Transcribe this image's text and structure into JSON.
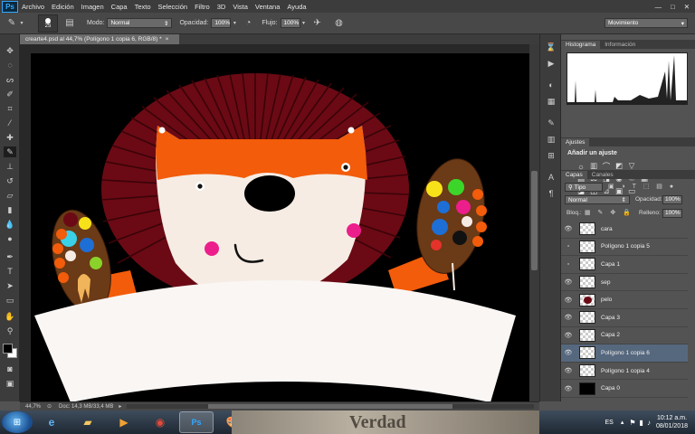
{
  "app": {
    "logo": "Ps"
  },
  "menu": [
    "Archivo",
    "Edición",
    "Imagen",
    "Capa",
    "Texto",
    "Selección",
    "Filtro",
    "3D",
    "Vista",
    "Ventana",
    "Ayuda"
  ],
  "options": {
    "brush_size": "25",
    "mode_label": "Modo:",
    "mode_value": "Normal",
    "opacity_label": "Opacidad:",
    "opacity_value": "100%",
    "flow_label": "Flujo:",
    "flow_value": "100%",
    "workspace": "Movimiento"
  },
  "document": {
    "tab_title": "crearte4.psd al 44,7% (Polígono 1 copia 6, RGB/8) *",
    "zoom": "44,7%",
    "doc_info": "Doc: 14,3 MB/33,4 MB"
  },
  "panels": {
    "histogram_tab": "Histograma",
    "info_tab": "Información",
    "adjustments_tab": "Ajustes",
    "add_adjustment": "Añadir un ajuste",
    "layers_tab": "Capas",
    "channels_tab": "Canales",
    "filter_kind": "Tipo",
    "blend_mode": "Normal",
    "opacity_label": "Opacidad:",
    "opacity_value": "100%",
    "lock_label": "Bloq.:",
    "fill_label": "Relleno:",
    "fill_value": "100%"
  },
  "layers": [
    {
      "name": "cara",
      "visible": true,
      "selected": false
    },
    {
      "name": "Polígono 1 copia 5",
      "visible": false,
      "selected": false
    },
    {
      "name": "Capa 1",
      "visible": false,
      "selected": false
    },
    {
      "name": "sep",
      "visible": true,
      "selected": false
    },
    {
      "name": "pelo",
      "visible": true,
      "selected": false
    },
    {
      "name": "Capa 3",
      "visible": true,
      "selected": false
    },
    {
      "name": "Capa 2",
      "visible": true,
      "selected": false
    },
    {
      "name": "Polígono 1 copia 6",
      "visible": true,
      "selected": true
    },
    {
      "name": "Polígono 1 copia 4",
      "visible": true,
      "selected": false
    },
    {
      "name": "Capa 0",
      "visible": true,
      "selected": false
    }
  ],
  "taskbar": {
    "language": "ES",
    "time": "10:12 a.m.",
    "date": "08/01/2018",
    "wallpaper_text": "Verdad"
  },
  "colors": {
    "mane": "#6b0a14",
    "face_orange": "#f25c0a",
    "face_cream": "#f6ece4",
    "palette_brown": "#6b3a17",
    "cheek_pink": "#ec1e8c",
    "selection": "#56687e"
  }
}
